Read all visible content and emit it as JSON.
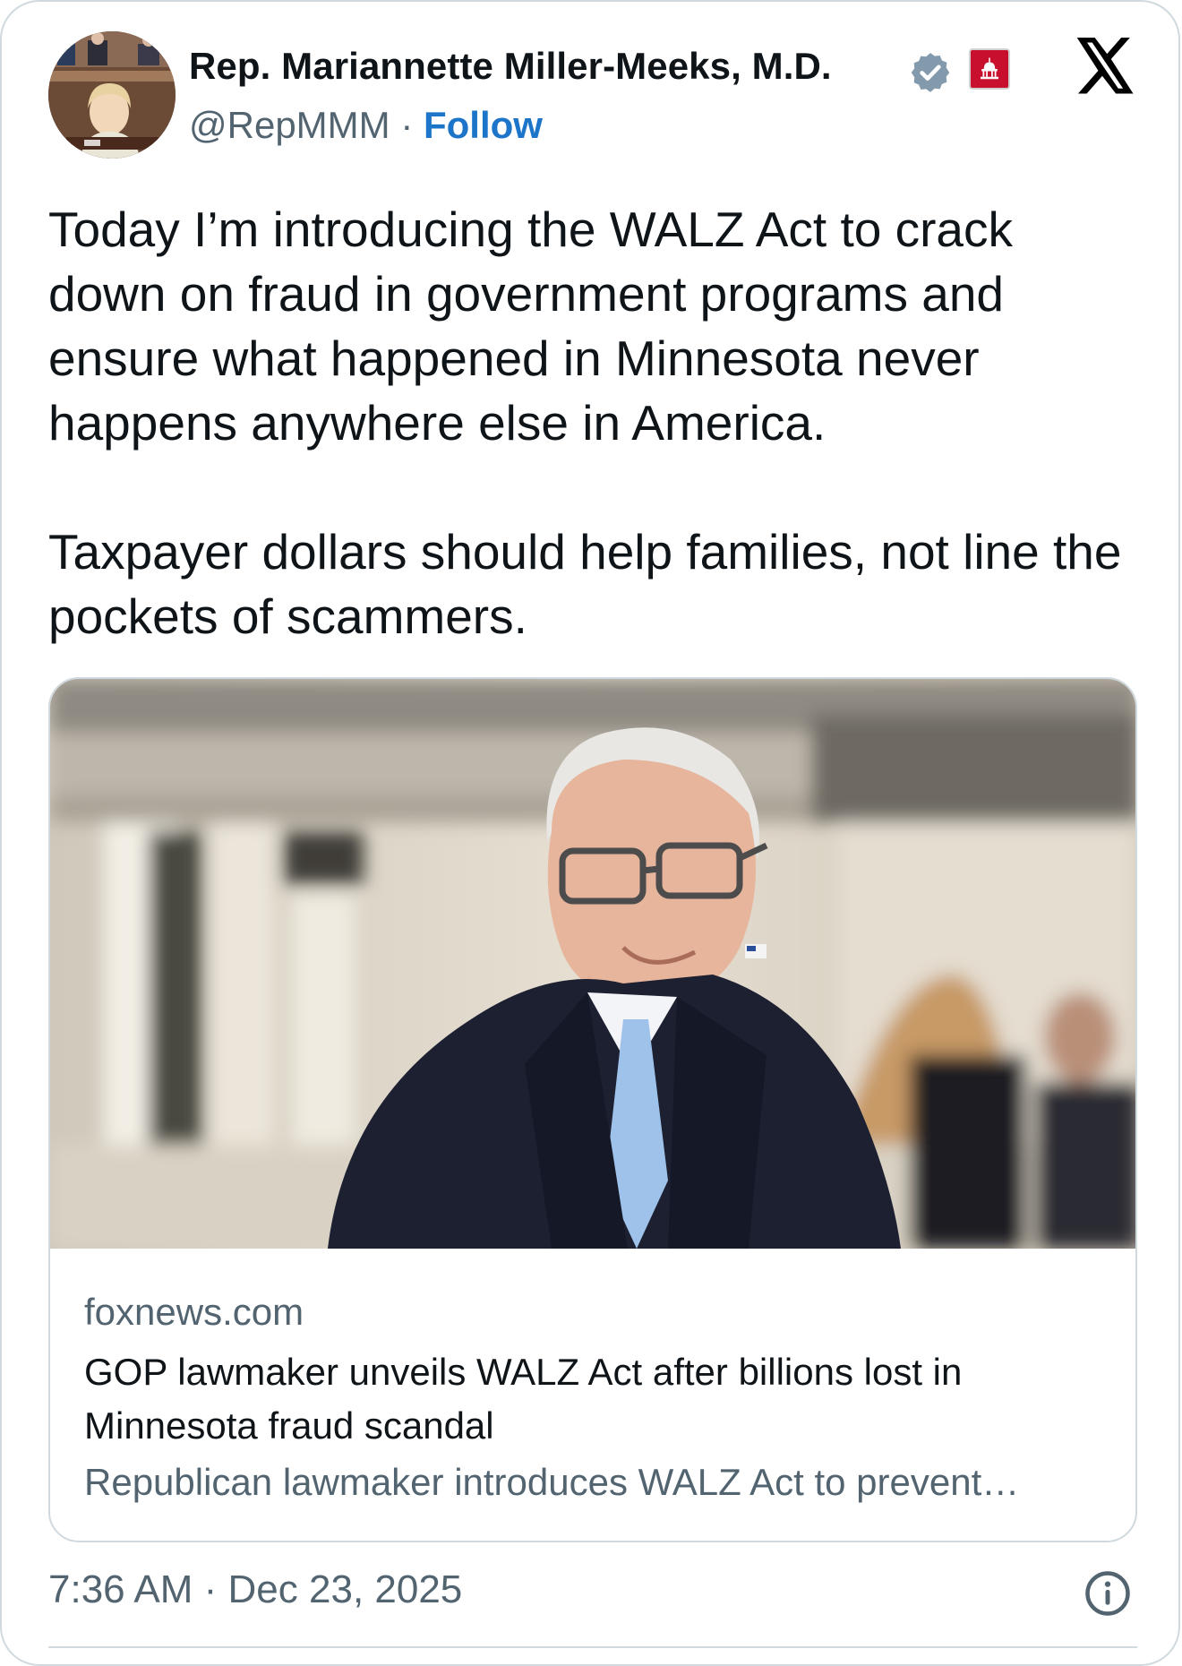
{
  "author": {
    "display_name": "Rep. Mariannette Miller-Meeks, M.D.",
    "handle": "@RepMMM",
    "separator": " · ",
    "follow_label": "Follow"
  },
  "tweet": {
    "paragraphs": [
      "Today I’m introducing the WALZ Act to crack down on fraud in government programs and ensure what happened in Minnesota never happens anywhere else in America.",
      "Taxpayer dollars should help families, not line the pockets of scammers."
    ]
  },
  "link_card": {
    "domain": "foxnews.com",
    "title": "GOP lawmaker unveils WALZ Act after billions lost in Minnesota fraud scandal",
    "description": "Republican lawmaker introduces WALZ Act to prevent…"
  },
  "timestamp": "7:36 AM · Dec 23, 2025",
  "icons": {
    "verified": "verified-badge-icon",
    "government": "capitol-badge-icon",
    "platform": "x-logo-icon",
    "info": "info-icon"
  },
  "colors": {
    "follow": "#1d75c9",
    "muted": "#536471",
    "border": "#cfd9de",
    "verified_badge": "#829aab",
    "gov_badge": "#c8102e"
  }
}
